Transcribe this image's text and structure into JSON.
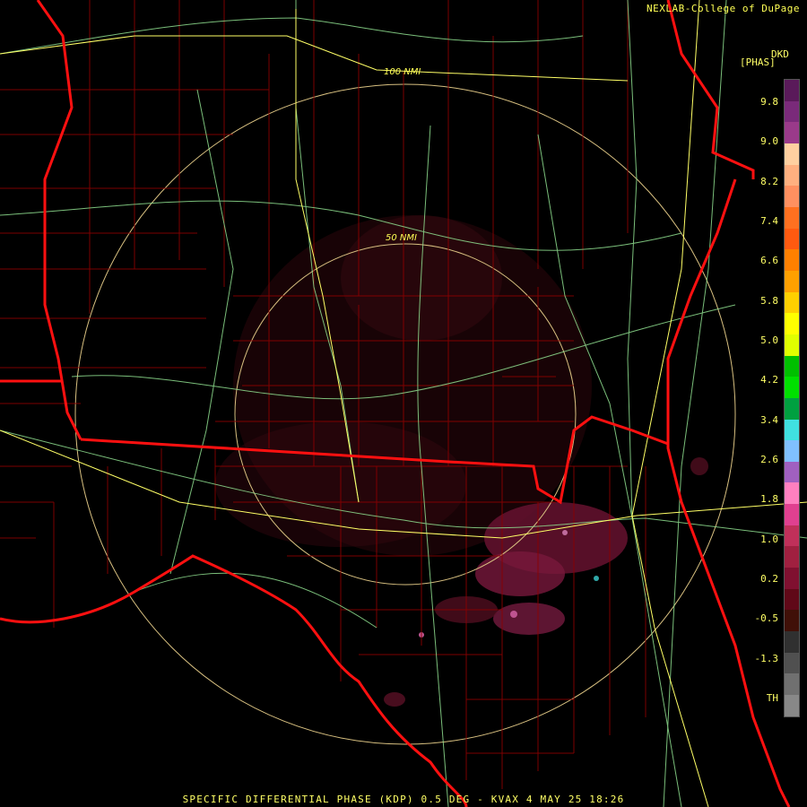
{
  "credit": "NEXLAB-College of DuPage",
  "product_footer": "SPECIFIC DIFFERENTIAL PHASE (KDP) 0.5 DEG - KVAX 4 MAY 25 18:26",
  "legend": {
    "units": "DKD",
    "mode": "[PHAS]",
    "ticks": [
      "9.8",
      "9.0",
      "8.2",
      "7.4",
      "6.6",
      "5.8",
      "5.0",
      "4.2",
      "3.4",
      "2.6",
      "1.8",
      "1.0",
      "0.2",
      "-0.5",
      "-1.3",
      "TH"
    ],
    "colors": [
      "#5a1a5a",
      "#7a2a7a",
      "#9a3a8a",
      "#ffd0a0",
      "#ffb080",
      "#ff9060",
      "#ff7020",
      "#ff5a10",
      "#ff8000",
      "#ffa000",
      "#ffd000",
      "#ffff00",
      "#e0ff00",
      "#00c000",
      "#00e000",
      "#00a040",
      "#40e0e0",
      "#80c0ff",
      "#a060c0",
      "#ff80c0",
      "#e04090",
      "#c0305a",
      "#a02040",
      "#801030",
      "#600818",
      "#401008",
      "#303030",
      "#505050",
      "#707070",
      "#888888"
    ]
  },
  "range_rings": [
    "100 NMI",
    "50 NMI"
  ]
}
